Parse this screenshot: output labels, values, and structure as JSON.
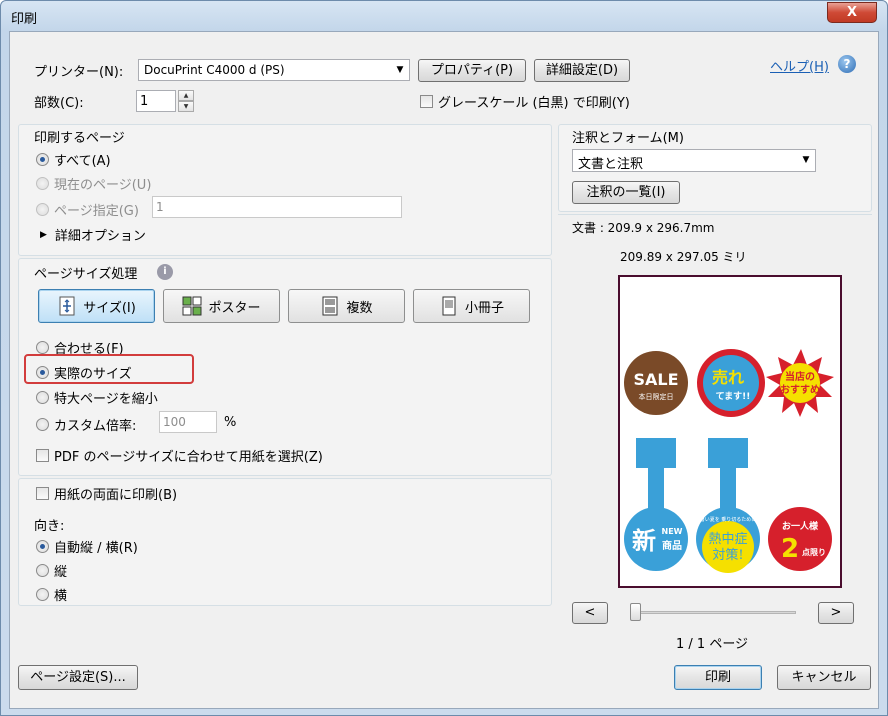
{
  "window": {
    "title": "印刷",
    "close_symbol": "X"
  },
  "printer": {
    "label": "プリンター(N):",
    "selected": "DocuPrint C4000 d (PS)",
    "properties_button": "プロパティ(P)",
    "advanced_button": "詳細設定(D)",
    "help_link": "ヘルプ(H)",
    "help_icon_glyph": "?"
  },
  "copies": {
    "label": "部数(C):",
    "value": "1"
  },
  "grayscale": {
    "label": "グレースケール (白黒) で印刷(Y)"
  },
  "pages": {
    "heading": "印刷するページ",
    "all": "すべて(A)",
    "current": "現在のページ(U)",
    "range": "ページ指定(G)",
    "range_value": "1",
    "more_options": "詳細オプション",
    "expand_glyph": "▶"
  },
  "page_sizing": {
    "heading": "ページサイズ処理",
    "info_glyph": "i",
    "buttons": [
      "サイズ(I)",
      "ポスター",
      "複数",
      "小冊子"
    ],
    "fit": "合わせる(F)",
    "actual_size": "実際のサイズ",
    "shrink": "特大ページを縮小",
    "custom_scale": "カスタム倍率:",
    "custom_value": "100",
    "percent": "%",
    "choose_paper": "PDF のページサイズに合わせて用紙を選択(Z)"
  },
  "duplex": {
    "label": "用紙の両面に印刷(B)"
  },
  "orientation": {
    "heading": "向き:",
    "auto": "自動縦 / 横(R)",
    "portrait": "縦",
    "landscape": "横"
  },
  "comments": {
    "heading": "注釈とフォーム(M)",
    "selected": "文書と注釈",
    "summarize_button": "注釈の一覧(I)"
  },
  "preview": {
    "doc_size": "文書 : 209.9 x 296.7mm",
    "page_size": "209.89 x 297.05 ミリ",
    "prev": "<",
    "next": ">",
    "page_count": "1 / 1 ページ",
    "stickers": {
      "sale": "SALE",
      "sale_sub": "本日限定日",
      "ureteru_top": "売れ",
      "ureteru_bottom": "てます!!",
      "toten": "当店の",
      "toten2": "おすすめ",
      "shin": "新",
      "new": "NEW",
      "shohin": "商品",
      "small_text": "暑い夏を 乗り切るために",
      "nettyu": "熱中症",
      "taisaku": "対策!",
      "hitori": "お一人様",
      "two": "2",
      "gentei": "点限り"
    }
  },
  "footer": {
    "page_setup": "ページ設定(S)...",
    "print": "印刷",
    "cancel": "キャンセル"
  },
  "colors": {
    "highlight": "#d23c3c",
    "accent": "#2a5a9c",
    "sticker_blue": "#3aa0d8",
    "sticker_red": "#d6202c",
    "sticker_yellow": "#f5e000",
    "sticker_brown": "#7a4a28"
  }
}
